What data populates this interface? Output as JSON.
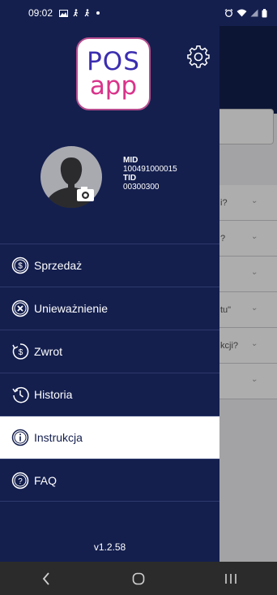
{
  "status_bar": {
    "time": "09:02",
    "left_icons": [
      "gallery-icon",
      "walk-icon",
      "walk-icon",
      "dot-icon"
    ],
    "right_icons": [
      "alarm-icon",
      "wifi-icon",
      "signal-icon",
      "battery-icon"
    ]
  },
  "drawer": {
    "logo": {
      "line1": "POS",
      "line2": "app"
    },
    "settings_icon": "gear-icon",
    "profile": {
      "avatar_icon": "user-silhouette-icon",
      "camera_icon": "camera-icon",
      "mid_label": "MID",
      "mid_value": "100491000015",
      "tid_label": "TID",
      "tid_value": "00300300"
    },
    "menu": [
      {
        "label": "Sprzedaż",
        "icon": "dollar-circle-icon",
        "active": false
      },
      {
        "label": "Unieważnienie",
        "icon": "x-circle-icon",
        "active": false
      },
      {
        "label": "Zwrot",
        "icon": "refund-icon",
        "active": false
      },
      {
        "label": "Historia",
        "icon": "history-icon",
        "active": false
      },
      {
        "label": "Instrukcja",
        "icon": "info-icon",
        "active": true
      },
      {
        "label": "FAQ",
        "icon": "question-icon",
        "active": false
      }
    ],
    "version": "v1.2.58"
  },
  "background": {
    "rows": [
      "i?",
      "?",
      "",
      "tu\"",
      "kcji?",
      ""
    ]
  },
  "nav_bar": {
    "icons": [
      "back-icon",
      "home-icon",
      "recents-icon"
    ]
  },
  "colors": {
    "drawer": "#141f4e",
    "logo_pos": "#3b2db0",
    "logo_app": "#d9338b"
  }
}
